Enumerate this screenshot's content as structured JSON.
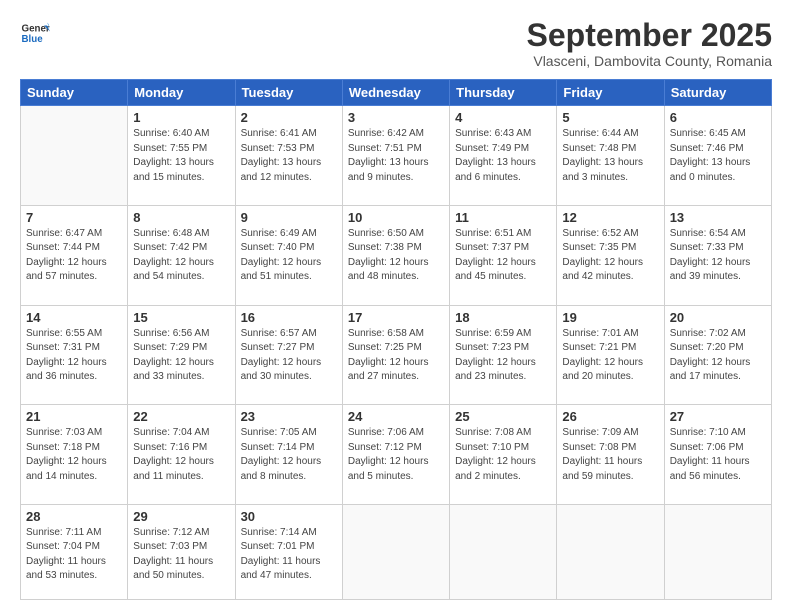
{
  "header": {
    "logo_line1": "General",
    "logo_line2": "Blue",
    "month_title": "September 2025",
    "location": "Vlasceni, Dambovita County, Romania"
  },
  "weekdays": [
    "Sunday",
    "Monday",
    "Tuesday",
    "Wednesday",
    "Thursday",
    "Friday",
    "Saturday"
  ],
  "weeks": [
    [
      {
        "day": "",
        "sunrise": "",
        "sunset": "",
        "daylight": ""
      },
      {
        "day": "1",
        "sunrise": "Sunrise: 6:40 AM",
        "sunset": "Sunset: 7:55 PM",
        "daylight": "Daylight: 13 hours and 15 minutes."
      },
      {
        "day": "2",
        "sunrise": "Sunrise: 6:41 AM",
        "sunset": "Sunset: 7:53 PM",
        "daylight": "Daylight: 13 hours and 12 minutes."
      },
      {
        "day": "3",
        "sunrise": "Sunrise: 6:42 AM",
        "sunset": "Sunset: 7:51 PM",
        "daylight": "Daylight: 13 hours and 9 minutes."
      },
      {
        "day": "4",
        "sunrise": "Sunrise: 6:43 AM",
        "sunset": "Sunset: 7:49 PM",
        "daylight": "Daylight: 13 hours and 6 minutes."
      },
      {
        "day": "5",
        "sunrise": "Sunrise: 6:44 AM",
        "sunset": "Sunset: 7:48 PM",
        "daylight": "Daylight: 13 hours and 3 minutes."
      },
      {
        "day": "6",
        "sunrise": "Sunrise: 6:45 AM",
        "sunset": "Sunset: 7:46 PM",
        "daylight": "Daylight: 13 hours and 0 minutes."
      }
    ],
    [
      {
        "day": "7",
        "sunrise": "Sunrise: 6:47 AM",
        "sunset": "Sunset: 7:44 PM",
        "daylight": "Daylight: 12 hours and 57 minutes."
      },
      {
        "day": "8",
        "sunrise": "Sunrise: 6:48 AM",
        "sunset": "Sunset: 7:42 PM",
        "daylight": "Daylight: 12 hours and 54 minutes."
      },
      {
        "day": "9",
        "sunrise": "Sunrise: 6:49 AM",
        "sunset": "Sunset: 7:40 PM",
        "daylight": "Daylight: 12 hours and 51 minutes."
      },
      {
        "day": "10",
        "sunrise": "Sunrise: 6:50 AM",
        "sunset": "Sunset: 7:38 PM",
        "daylight": "Daylight: 12 hours and 48 minutes."
      },
      {
        "day": "11",
        "sunrise": "Sunrise: 6:51 AM",
        "sunset": "Sunset: 7:37 PM",
        "daylight": "Daylight: 12 hours and 45 minutes."
      },
      {
        "day": "12",
        "sunrise": "Sunrise: 6:52 AM",
        "sunset": "Sunset: 7:35 PM",
        "daylight": "Daylight: 12 hours and 42 minutes."
      },
      {
        "day": "13",
        "sunrise": "Sunrise: 6:54 AM",
        "sunset": "Sunset: 7:33 PM",
        "daylight": "Daylight: 12 hours and 39 minutes."
      }
    ],
    [
      {
        "day": "14",
        "sunrise": "Sunrise: 6:55 AM",
        "sunset": "Sunset: 7:31 PM",
        "daylight": "Daylight: 12 hours and 36 minutes."
      },
      {
        "day": "15",
        "sunrise": "Sunrise: 6:56 AM",
        "sunset": "Sunset: 7:29 PM",
        "daylight": "Daylight: 12 hours and 33 minutes."
      },
      {
        "day": "16",
        "sunrise": "Sunrise: 6:57 AM",
        "sunset": "Sunset: 7:27 PM",
        "daylight": "Daylight: 12 hours and 30 minutes."
      },
      {
        "day": "17",
        "sunrise": "Sunrise: 6:58 AM",
        "sunset": "Sunset: 7:25 PM",
        "daylight": "Daylight: 12 hours and 27 minutes."
      },
      {
        "day": "18",
        "sunrise": "Sunrise: 6:59 AM",
        "sunset": "Sunset: 7:23 PM",
        "daylight": "Daylight: 12 hours and 23 minutes."
      },
      {
        "day": "19",
        "sunrise": "Sunrise: 7:01 AM",
        "sunset": "Sunset: 7:21 PM",
        "daylight": "Daylight: 12 hours and 20 minutes."
      },
      {
        "day": "20",
        "sunrise": "Sunrise: 7:02 AM",
        "sunset": "Sunset: 7:20 PM",
        "daylight": "Daylight: 12 hours and 17 minutes."
      }
    ],
    [
      {
        "day": "21",
        "sunrise": "Sunrise: 7:03 AM",
        "sunset": "Sunset: 7:18 PM",
        "daylight": "Daylight: 12 hours and 14 minutes."
      },
      {
        "day": "22",
        "sunrise": "Sunrise: 7:04 AM",
        "sunset": "Sunset: 7:16 PM",
        "daylight": "Daylight: 12 hours and 11 minutes."
      },
      {
        "day": "23",
        "sunrise": "Sunrise: 7:05 AM",
        "sunset": "Sunset: 7:14 PM",
        "daylight": "Daylight: 12 hours and 8 minutes."
      },
      {
        "day": "24",
        "sunrise": "Sunrise: 7:06 AM",
        "sunset": "Sunset: 7:12 PM",
        "daylight": "Daylight: 12 hours and 5 minutes."
      },
      {
        "day": "25",
        "sunrise": "Sunrise: 7:08 AM",
        "sunset": "Sunset: 7:10 PM",
        "daylight": "Daylight: 12 hours and 2 minutes."
      },
      {
        "day": "26",
        "sunrise": "Sunrise: 7:09 AM",
        "sunset": "Sunset: 7:08 PM",
        "daylight": "Daylight: 11 hours and 59 minutes."
      },
      {
        "day": "27",
        "sunrise": "Sunrise: 7:10 AM",
        "sunset": "Sunset: 7:06 PM",
        "daylight": "Daylight: 11 hours and 56 minutes."
      }
    ],
    [
      {
        "day": "28",
        "sunrise": "Sunrise: 7:11 AM",
        "sunset": "Sunset: 7:04 PM",
        "daylight": "Daylight: 11 hours and 53 minutes."
      },
      {
        "day": "29",
        "sunrise": "Sunrise: 7:12 AM",
        "sunset": "Sunset: 7:03 PM",
        "daylight": "Daylight: 11 hours and 50 minutes."
      },
      {
        "day": "30",
        "sunrise": "Sunrise: 7:14 AM",
        "sunset": "Sunset: 7:01 PM",
        "daylight": "Daylight: 11 hours and 47 minutes."
      },
      {
        "day": "",
        "sunrise": "",
        "sunset": "",
        "daylight": ""
      },
      {
        "day": "",
        "sunrise": "",
        "sunset": "",
        "daylight": ""
      },
      {
        "day": "",
        "sunrise": "",
        "sunset": "",
        "daylight": ""
      },
      {
        "day": "",
        "sunrise": "",
        "sunset": "",
        "daylight": ""
      }
    ]
  ]
}
